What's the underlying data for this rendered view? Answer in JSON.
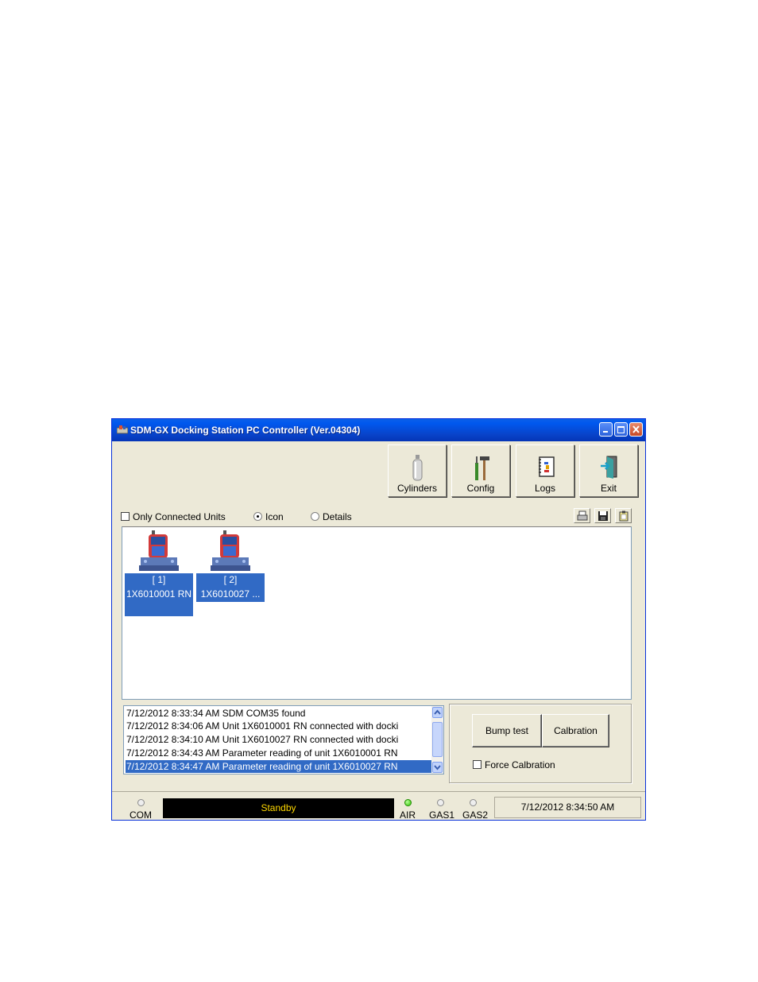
{
  "window": {
    "title": "SDM-GX Docking Station PC Controller (Ver.04304)"
  },
  "toolbar": {
    "buttons": [
      {
        "label": "Cylinders",
        "icon": "cylinder-icon"
      },
      {
        "label": "Config",
        "icon": "tools-icon"
      },
      {
        "label": "Logs",
        "icon": "logbook-icon"
      },
      {
        "label": "Exit",
        "icon": "exit-door-icon"
      }
    ]
  },
  "view_options": {
    "only_connected_label": "Only Connected Units",
    "only_connected_checked": false,
    "icon_label": "Icon",
    "details_label": "Details",
    "selected_view": "Icon"
  },
  "units": [
    {
      "slot": "[ 1]",
      "name": "1X6010001 RN"
    },
    {
      "slot": "[ 2]",
      "name": "1X6010027 ..."
    }
  ],
  "log": {
    "entries": [
      "7/12/2012 8:33:34 AM SDM COM35 found",
      "7/12/2012 8:34:06 AM Unit 1X6010001 RN connected with docki",
      "7/12/2012 8:34:10 AM Unit 1X6010027 RN connected with docki",
      "7/12/2012 8:34:43 AM Parameter reading of unit 1X6010001 RN",
      "7/12/2012 8:34:47 AM Parameter reading of unit 1X6010027 RN"
    ],
    "selected_index": 4
  },
  "actions": {
    "bump_test_label": "Bump test",
    "calibration_label": "Calbration",
    "force_calibration_label": "Force Calbration",
    "force_calibration_checked": false
  },
  "status": {
    "com_label": "COM",
    "state": "Standby",
    "air_label": "AIR",
    "gas1_label": "GAS1",
    "gas2_label": "GAS2",
    "air_led_color": "#30c400",
    "datetime": "7/12/2012 8:34:50 AM"
  }
}
